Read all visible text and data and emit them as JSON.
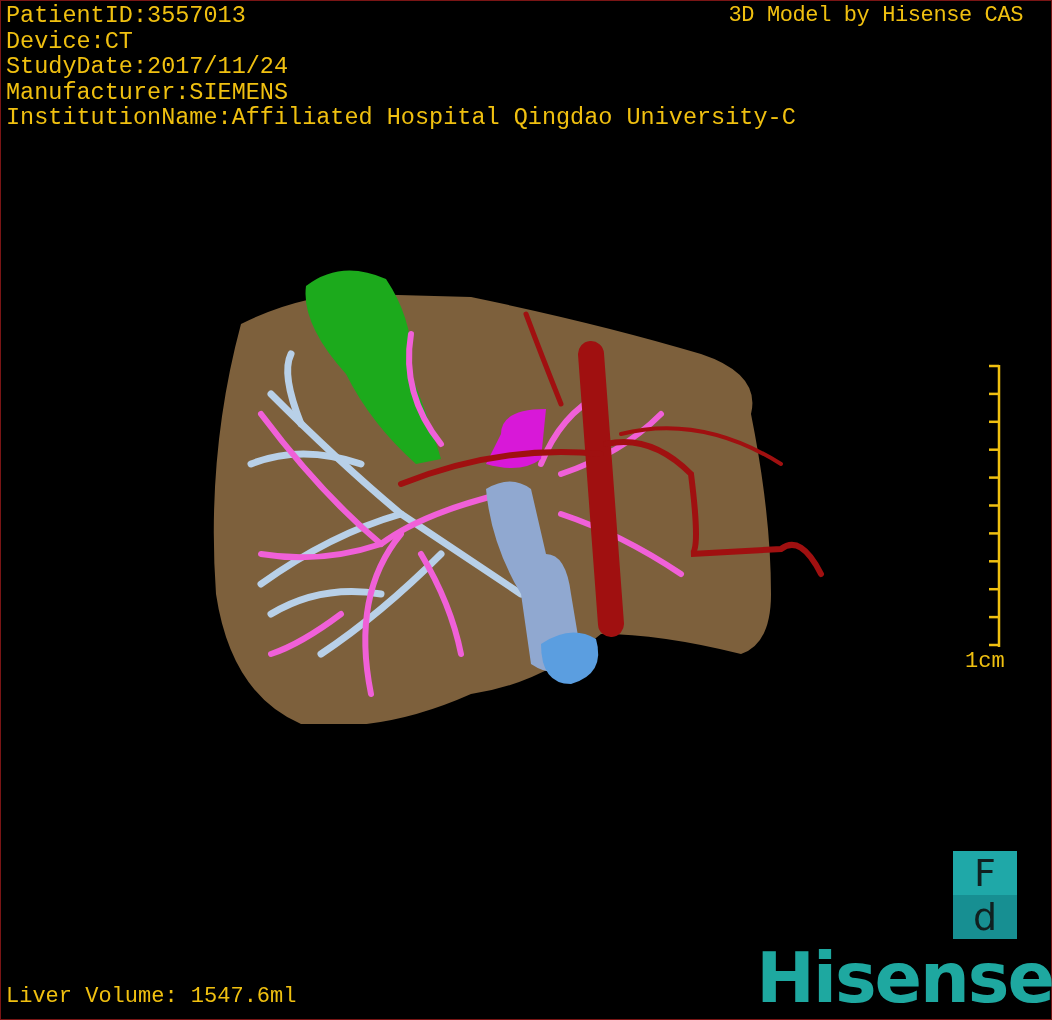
{
  "overlay": {
    "info_lines": [
      "PatientID:3557013",
      "Device:CT",
      "StudyDate:2017/11/24",
      "Manufacturer:SIEMENS",
      "InstitutionName:Affiliated Hospital Qingdao University-C"
    ],
    "title": "3D Model by Hisense CAS",
    "scale_bar": {
      "label": "1cm"
    },
    "volume": "Liver Volume: 1547.6ml"
  },
  "orientation_cube": {
    "top": "F",
    "bottom": "d"
  },
  "logo": "Hisense"
}
